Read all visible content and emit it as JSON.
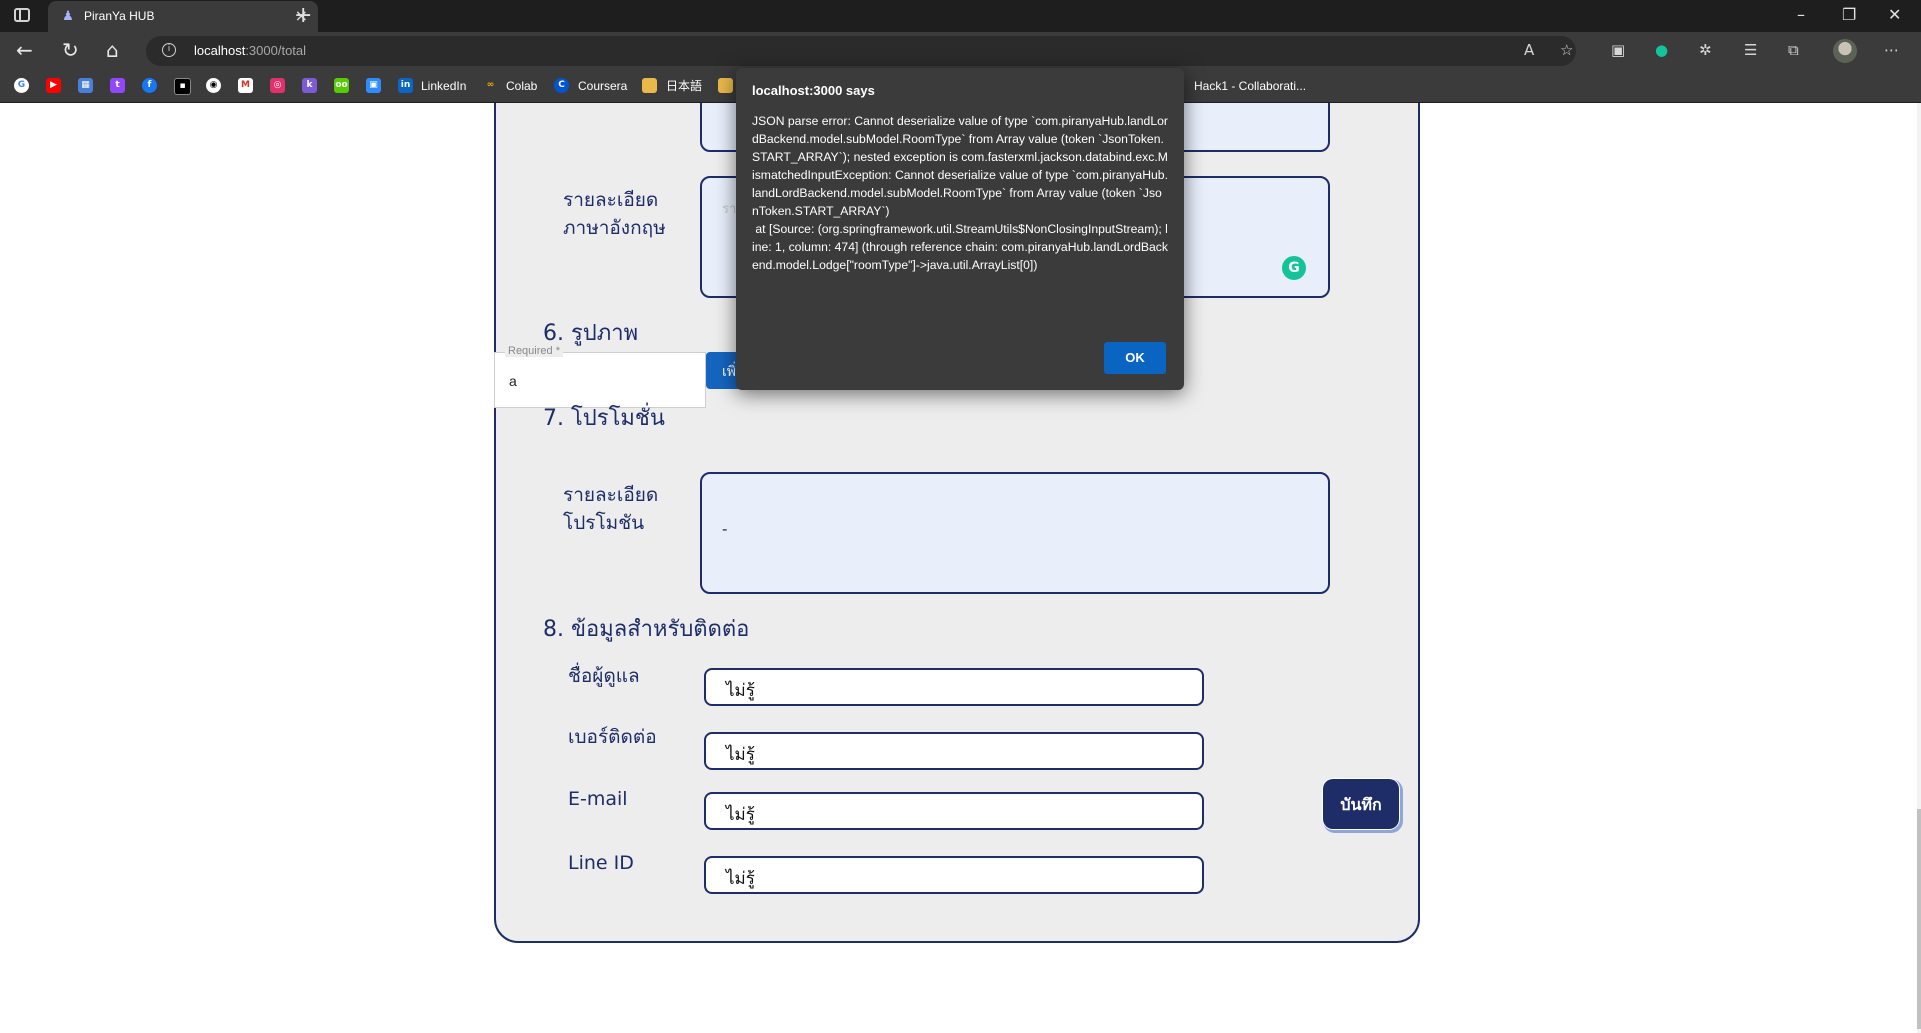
{
  "browser": {
    "tab_title": "PiranYa HUB",
    "url_host": "localhost",
    "url_rest": ":3000/total",
    "bookmarks": [
      "LinkedIn",
      "Colab",
      "Coursera",
      "日本語",
      "Hack1 - Collaborati..."
    ]
  },
  "form": {
    "english_detail_label_1": "รายละเอียด",
    "english_detail_label_2": "ภาษาอังกฤษ",
    "english_detail_placeholder": "รา",
    "section6_title": "6. รูปภาพ",
    "required_legend": "Required *",
    "required_value": "a",
    "add_button_label": "เพิ่ม",
    "section7_title": "7. โปรโมชั่น",
    "promo_label_1": "รายละเอียด",
    "promo_label_2": "โปรโมชัน",
    "promo_value": "-",
    "section8_title": "8. ข้อมูลสำหรับติดต่อ",
    "contacts": [
      {
        "label": "ชื่อผู้ดูแล",
        "value": "ไม่รู้"
      },
      {
        "label": "เบอร์ติดต่อ",
        "value": "ไม่รู้"
      },
      {
        "label": "E-mail",
        "value": "ไม่รู้"
      },
      {
        "label": "Line ID",
        "value": "ไม่รู้"
      }
    ],
    "save_label": "บันทึก"
  },
  "dialog": {
    "title": "localhost:3000 says",
    "message": "JSON parse error: Cannot deserialize value of type `com.piranyaHub.landLordBackend.model.subModel.RoomType` from Array value (token `JsonToken.START_ARRAY`); nested exception is com.fasterxml.jackson.databind.exc.MismatchedInputException: Cannot deserialize value of type `com.piranyaHub.landLordBackend.model.subModel.RoomType` from Array value (token `JsonToken.START_ARRAY`)\n at [Source: (org.springframework.util.StreamUtils$NonClosingInputStream); line: 1, column: 474] (through reference chain: com.piranyaHub.landLordBackend.model.Lodge[\"roomType\"]->java.util.ArrayList[0])",
    "ok_label": "OK"
  }
}
